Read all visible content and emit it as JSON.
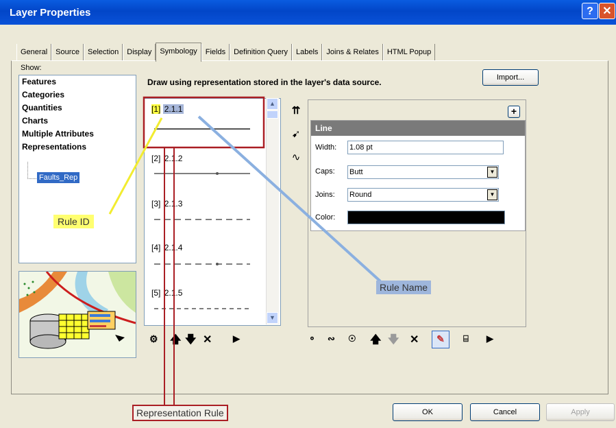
{
  "window": {
    "title": "Layer Properties",
    "help_label": "?",
    "close_label": "✕"
  },
  "tabs": [
    "General",
    "Source",
    "Selection",
    "Display",
    "Symbology",
    "Fields",
    "Definition Query",
    "Labels",
    "Joins & Relates",
    "HTML Popup"
  ],
  "active_tab": "Symbology",
  "show": {
    "label": "Show:",
    "items": [
      "Features",
      "Categories",
      "Quantities",
      "Charts",
      "Multiple Attributes",
      "Representations"
    ],
    "subitem": "Faults_Rep"
  },
  "draw_label": "Draw using representation stored in the layer's data source.",
  "import_label": "Import...",
  "rules": [
    {
      "id": "[1]",
      "name": "2.1.1",
      "selected": true,
      "style": "solid"
    },
    {
      "id": "[2]",
      "name": "2.1.2",
      "selected": false,
      "style": "solid-tick"
    },
    {
      "id": "[3]",
      "name": "2.1.3",
      "selected": false,
      "style": "dash"
    },
    {
      "id": "[4]",
      "name": "2.1.4",
      "selected": false,
      "style": "dash-tick"
    },
    {
      "id": "[5]",
      "name": "2.1.5",
      "selected": false,
      "style": "dash-short"
    }
  ],
  "line_props": {
    "header": "Line",
    "width_label": "Width:",
    "width_value": "1.08 pt",
    "caps_label": "Caps:",
    "caps_value": "Butt",
    "joins_label": "Joins:",
    "joins_value": "Round",
    "color_label": "Color:",
    "color_value": "#000000"
  },
  "buttons": {
    "ok": "OK",
    "cancel": "Cancel",
    "apply": "Apply"
  },
  "annotations": {
    "rule_id": "Rule ID",
    "rule_name": "Rule Name",
    "representation_rule": "Representation Rule"
  },
  "colors": {
    "title_bar": "#0a52d8",
    "selection": "#316ac5",
    "annotation_red": "#aa1e24",
    "annotation_yellow": "#ffff40",
    "annotation_blue": "#9eb6dc"
  }
}
